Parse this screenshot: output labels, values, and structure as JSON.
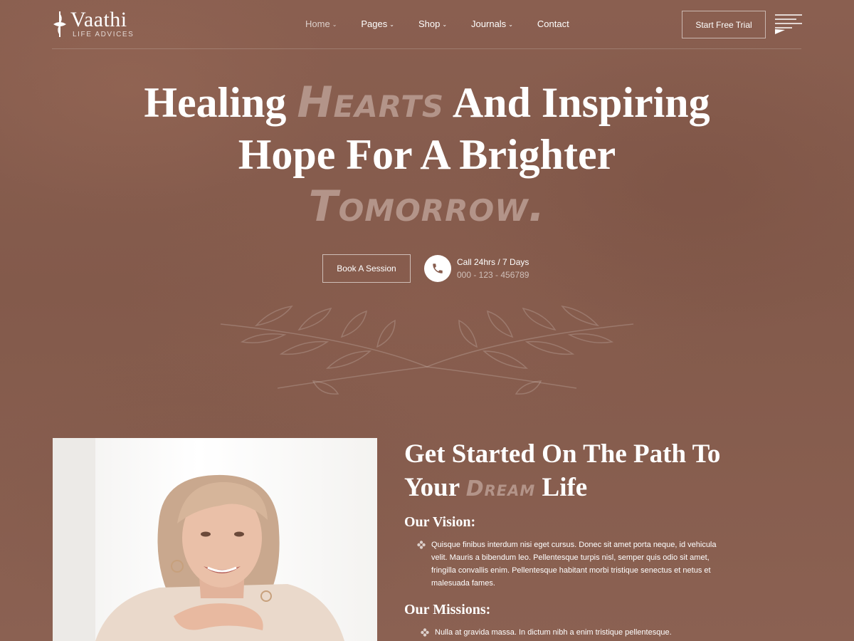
{
  "brand": {
    "name": "Vaathi",
    "tagline": "LIFE ADVICES"
  },
  "nav": {
    "items": [
      {
        "label": "Home",
        "dropdown": true,
        "active": true
      },
      {
        "label": "Pages",
        "dropdown": true,
        "active": false
      },
      {
        "label": "Shop",
        "dropdown": true,
        "active": false
      },
      {
        "label": "Journals",
        "dropdown": true,
        "active": false
      },
      {
        "label": "Contact",
        "dropdown": false,
        "active": false
      }
    ],
    "caret": "⌄",
    "trial_button": "Start Free Trial",
    "menu_icon": "hamburger-menu-icon"
  },
  "hero": {
    "line1_a": "Healing",
    "line1_accent": "Hearts",
    "line1_b": "And Inspiring",
    "line2": "Hope For A Brighter",
    "line3_accent": "Tomorrow.",
    "book_button": "Book A Session",
    "call_label": "Call 24hrs / 7 Days",
    "call_number": "000 - 123 - 456789",
    "phone_icon": "phone-icon",
    "decoration_icon": "laurel-branch-icon"
  },
  "about": {
    "title_a": "Get Started On The Path To",
    "title_b": "Your",
    "title_accent": "Dream",
    "title_c": "Life",
    "vision_heading": "Our Vision:",
    "vision_text": "Quisque finibus interdum nisi eget cursus. Donec sit amet porta neque, id vehicula velit. Mauris a bibendum leo. Pellentesque turpis nisl, semper quis odio sit amet, fringilla convallis enim. Pellentesque habitant morbi tristique senectus et netus et malesuada fames.",
    "missions_heading": "Our Missions:",
    "missions_text": "Nulla at gravida massa. In dictum nibh a enim tristique pellentesque.",
    "bullet_icon": "flower-bullet-icon"
  },
  "colors": {
    "background": "#875c4d",
    "accent_text": "#b39489",
    "text": "#ffffff"
  }
}
